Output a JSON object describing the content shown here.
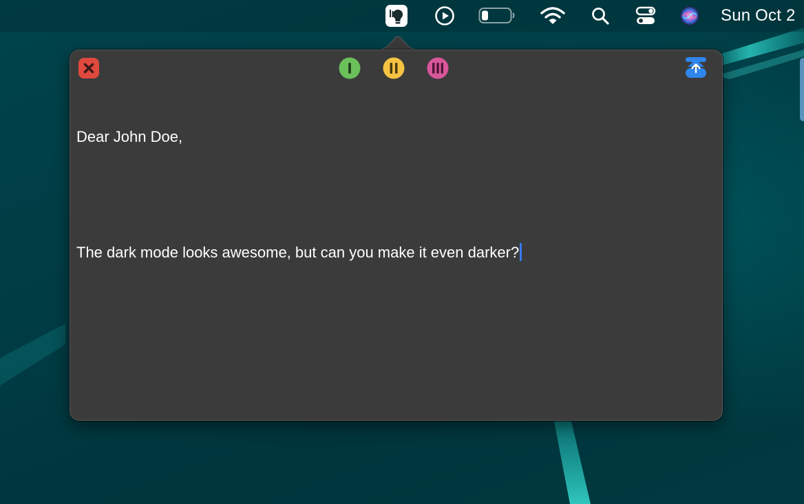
{
  "menubar": {
    "icons": [
      {
        "name": "lightbulb-notes-app-icon",
        "active": true
      },
      {
        "name": "play-circle-icon"
      },
      {
        "name": "battery-icon",
        "level_percent": 20
      },
      {
        "name": "wifi-icon"
      },
      {
        "name": "search-icon"
      },
      {
        "name": "control-center-icon"
      },
      {
        "name": "siri-icon"
      }
    ],
    "clock": "Sun Oct 2"
  },
  "note": {
    "toolbar": {
      "close": {
        "icon": "close-icon",
        "color": "#e0493e"
      },
      "layouts": [
        {
          "name": "layout-one-button",
          "icon": "one-bar-icon",
          "color": "#6ac15a"
        },
        {
          "name": "layout-two-button",
          "icon": "two-bars-icon",
          "color": "#f5c242"
        },
        {
          "name": "layout-three-button",
          "icon": "three-bars-icon",
          "color": "#d9569b"
        }
      ],
      "detach": {
        "icon": "detach-window-icon",
        "color": "#2f86ec"
      }
    },
    "lines": [
      "Dear John Doe,",
      "",
      "The dark mode looks awesome, but can you make it even darker?"
    ]
  },
  "colors": {
    "popover_bg": "#3b3b3b",
    "text": "#ffffff",
    "caret": "#3a78f2",
    "desktop": "#003a42"
  }
}
